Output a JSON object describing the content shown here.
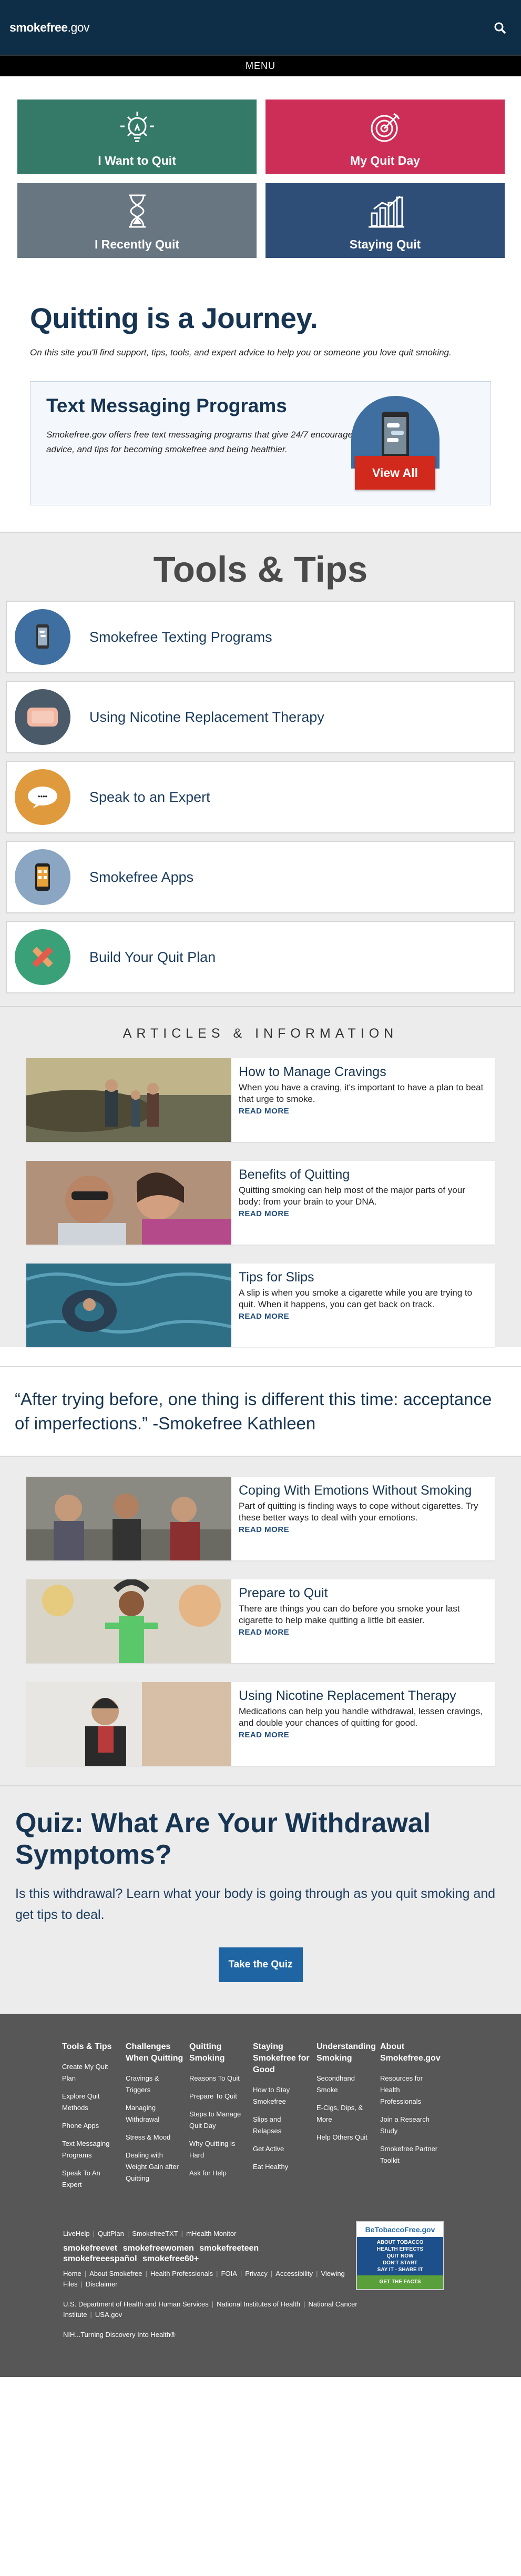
{
  "header": {
    "logo_main": "smokefree",
    "logo_suffix": ".gov",
    "search_icon": "search-icon"
  },
  "menu": {
    "label": "MENU"
  },
  "tiles": [
    {
      "label": "I Want to Quit",
      "color": "#357a68",
      "icon": "lightbulb-icon"
    },
    {
      "label": "My Quit Day",
      "color": "#cc2e57",
      "icon": "target-icon"
    },
    {
      "label": "I Recently Quit",
      "color": "#687682",
      "icon": "hourglass-icon"
    },
    {
      "label": "Staying Quit",
      "color": "#2f4e77",
      "icon": "bar-chart-icon"
    }
  ],
  "journey": {
    "title": "Quitting is a Journey.",
    "text": "On this site you'll find support, tips, tools, and expert advice to help you or someone you love quit smoking."
  },
  "texting": {
    "title": "Text Messaging Programs",
    "text": "Smokefree.gov offers free text messaging programs that give 24/7 encouragement, advice, and tips for becoming smokefree and being healthier.",
    "button": "View All"
  },
  "tools": {
    "title": "Tools & Tips",
    "items": [
      {
        "label": "Smokefree Texting Programs",
        "color": "#3f6fa0",
        "icon": "phone-icon"
      },
      {
        "label": "Using Nicotine Replacement Therapy",
        "color": "#4a5a68",
        "icon": "patch-icon"
      },
      {
        "label": "Speak to an Expert",
        "color": "#e09a3e",
        "icon": "speech-bubble-icon",
        "bubble_text": "••••"
      },
      {
        "label": "Smokefree Apps",
        "color": "#8aa6c2",
        "icon": "smartphone-icon"
      },
      {
        "label": "Build Your Quit Plan",
        "color": "#3aa078",
        "icon": "cross-icon"
      }
    ]
  },
  "articles": {
    "heading": "ARTICLES & INFORMATION",
    "read_more": "READ MORE",
    "items": [
      {
        "title": "How to Manage Cravings",
        "text": "When you have a craving, it's important to have a plan to beat that urge to smoke."
      },
      {
        "title": "Benefits of Quitting",
        "text": "Quitting smoking can help most of the major parts of your body: from your brain to your DNA."
      },
      {
        "title": "Tips for Slips",
        "text": "A slip is when you smoke a cigarette while you are trying to quit. When it happens, you can get back on track."
      }
    ],
    "items2": [
      {
        "title": "Coping With Emotions Without Smoking",
        "text": "Part of quitting is finding ways to cope without cigarettes. Try these better ways to deal with your emotions."
      },
      {
        "title": "Prepare to Quit",
        "text": "There are things you can do before you smoke your last cigarette to help make quitting a little bit easier."
      },
      {
        "title": "Using Nicotine Replacement Therapy",
        "text": "Medications can help you handle withdrawal, lessen cravings, and double your chances of quitting for good."
      }
    ]
  },
  "quote": {
    "text": "“After trying before, one thing is different this time: acceptance of imperfections.” -Smokefree Kathleen"
  },
  "quiz": {
    "title": "Quiz: What Are Your Withdrawal Symptoms?",
    "text": "Is this withdrawal? Learn what your body is going through as you quit smoking and get tips to deal.",
    "button": "Take the Quiz"
  },
  "footer": {
    "cols": [
      {
        "title": "Tools & Tips",
        "links": [
          "Create My Quit Plan",
          "Explore Quit Methods",
          "Phone Apps",
          "Text Messaging Programs",
          "Speak To An Expert"
        ]
      },
      {
        "title": "Challenges When Quitting",
        "links": [
          "Cravings & Triggers",
          "Managing Withdrawal",
          "Stress & Mood",
          "Dealing with Weight Gain after Quitting"
        ]
      },
      {
        "title": "Quitting Smoking",
        "links": [
          "Reasons To Quit",
          "Prepare To Quit",
          "Steps to Manage Quit Day",
          "Why Quitting is Hard",
          "Ask for Help"
        ]
      },
      {
        "title": "Staying Smokefree for Good",
        "links": [
          "How to Stay Smokefree",
          "Slips and Relapses",
          "Get Active",
          "Eat Healthy"
        ]
      },
      {
        "title": "Understanding Smoking",
        "links": [
          "Secondhand Smoke",
          "E-Cigs, Dips, & More",
          "Help Others Quit"
        ]
      },
      {
        "title": "About Smokefree.gov",
        "links": [
          "Resources for Health Professionals",
          "Join a Research Study",
          "Smokefree Partner Toolkit"
        ]
      }
    ],
    "partners": [
      "LiveHelp",
      "QuitPlan",
      "SmokefreeTXT",
      "mHealth Monitor"
    ],
    "brands": [
      "smokefreevet",
      "smokefreewomen",
      "smokefreeteen",
      "smokefreeespañol",
      "smokefree60+"
    ],
    "links1": [
      "Home",
      "About Smokefree",
      "Health Professionals",
      "FOIA",
      "Privacy",
      "Accessibility",
      "Viewing Files",
      "Disclaimer"
    ],
    "links2": [
      "U.S. Department of Health and Human Services",
      "National Institutes of Health",
      "National Cancer Institute",
      "USA.gov"
    ],
    "tagline": "NIH...Turning Discovery Into Health®",
    "badge_title": "BeTobaccoFree.gov",
    "badge_lines": [
      "ABOUT TOBACCO",
      "HEALTH EFFECTS",
      "QUIT NOW",
      "DON'T START",
      "SAY IT - SHARE IT"
    ],
    "badge_cta": "GET THE FACTS"
  }
}
